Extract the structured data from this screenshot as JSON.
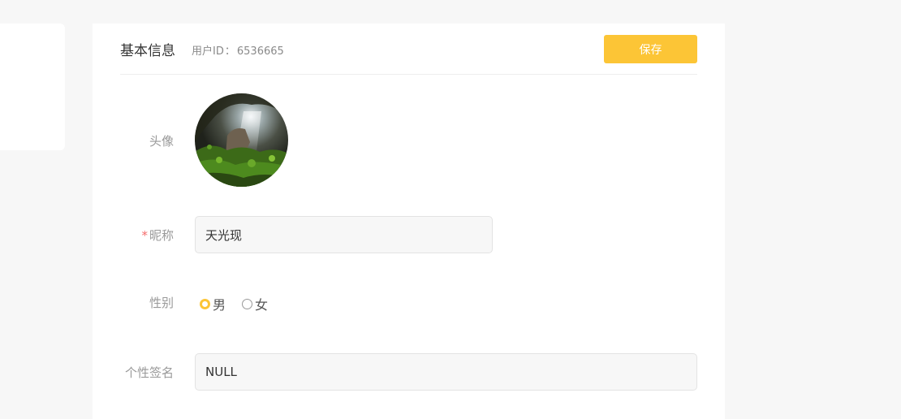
{
  "header": {
    "title": "基本信息",
    "user_id_label": "用户ID",
    "user_id_separator": "：",
    "user_id_value": "6536665",
    "save_label": "保存"
  },
  "form": {
    "avatar_label": "头像",
    "nickname_required_mark": "*",
    "nickname_label": "昵称",
    "nickname_value": "天光现",
    "gender_label": "性别",
    "gender_options": [
      {
        "label": "男",
        "selected": true
      },
      {
        "label": "女",
        "selected": false
      }
    ],
    "signature_label": "个性签名",
    "signature_value": "NULL"
  },
  "colors": {
    "accent": "#fcc536",
    "required": "#f56c6c",
    "page_bg": "#f7f7f7"
  }
}
